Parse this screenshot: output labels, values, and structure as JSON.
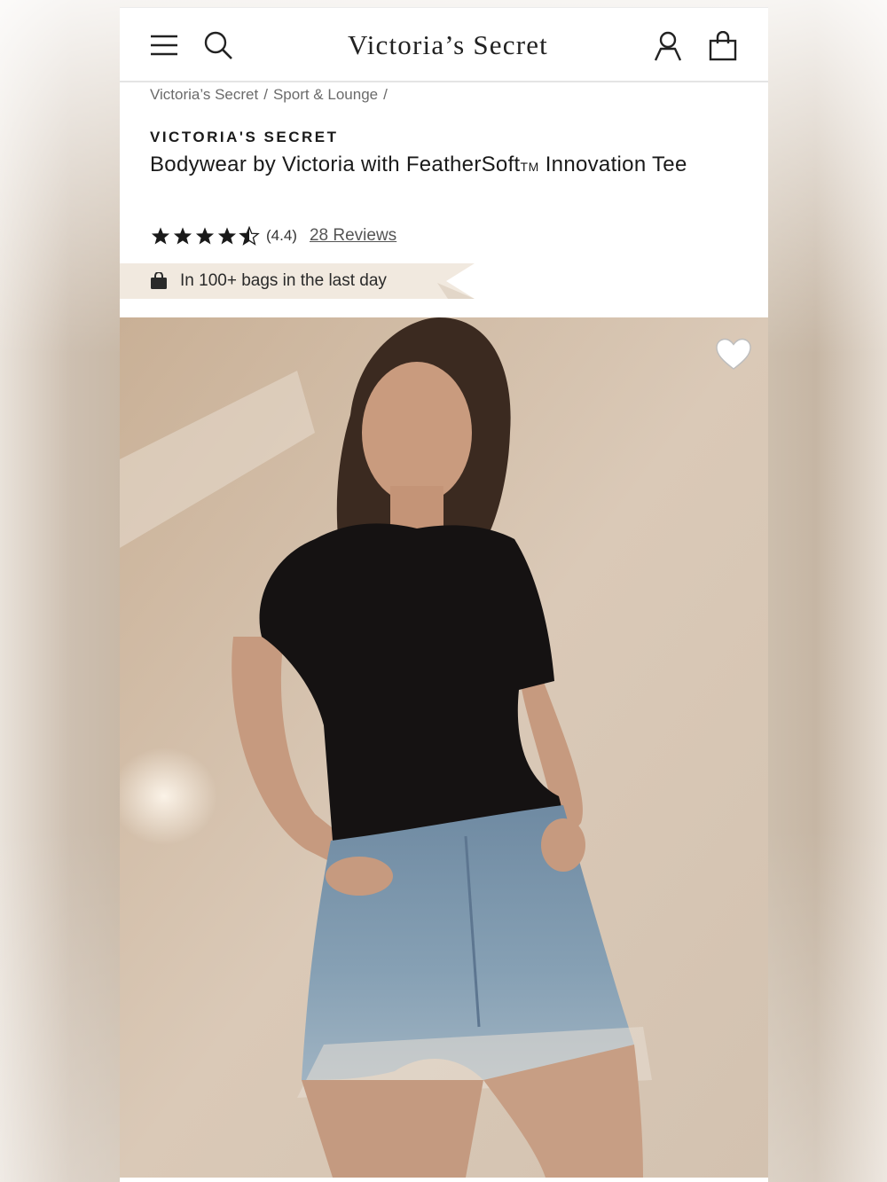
{
  "header": {
    "brand": "Victoria’s Secret",
    "icons": {
      "menu": "menu-icon",
      "search": "search-icon",
      "account": "account-icon",
      "bag": "shopping-bag-icon"
    }
  },
  "breadcrumb": [
    "Victoria’s Secret",
    "Sport & Lounge"
  ],
  "breadcrumb_separator": "/",
  "product": {
    "brand": "VICTORIA'S SECRET",
    "title_main": "Bodywear by Victoria with FeatherSoft",
    "title_tm": "TM",
    "title_rest": " Innovation Tee",
    "rating": 4.4,
    "rating_label": "(4.4)",
    "reviews_label": "28 Reviews"
  },
  "badge": {
    "icon": "bag-icon",
    "text": "In 100+ bags in the last day"
  },
  "hero": {
    "favorite_icon": "heart-icon"
  },
  "colors": {
    "text": "#1a1a1a",
    "ribbon": "#f1e9df"
  }
}
